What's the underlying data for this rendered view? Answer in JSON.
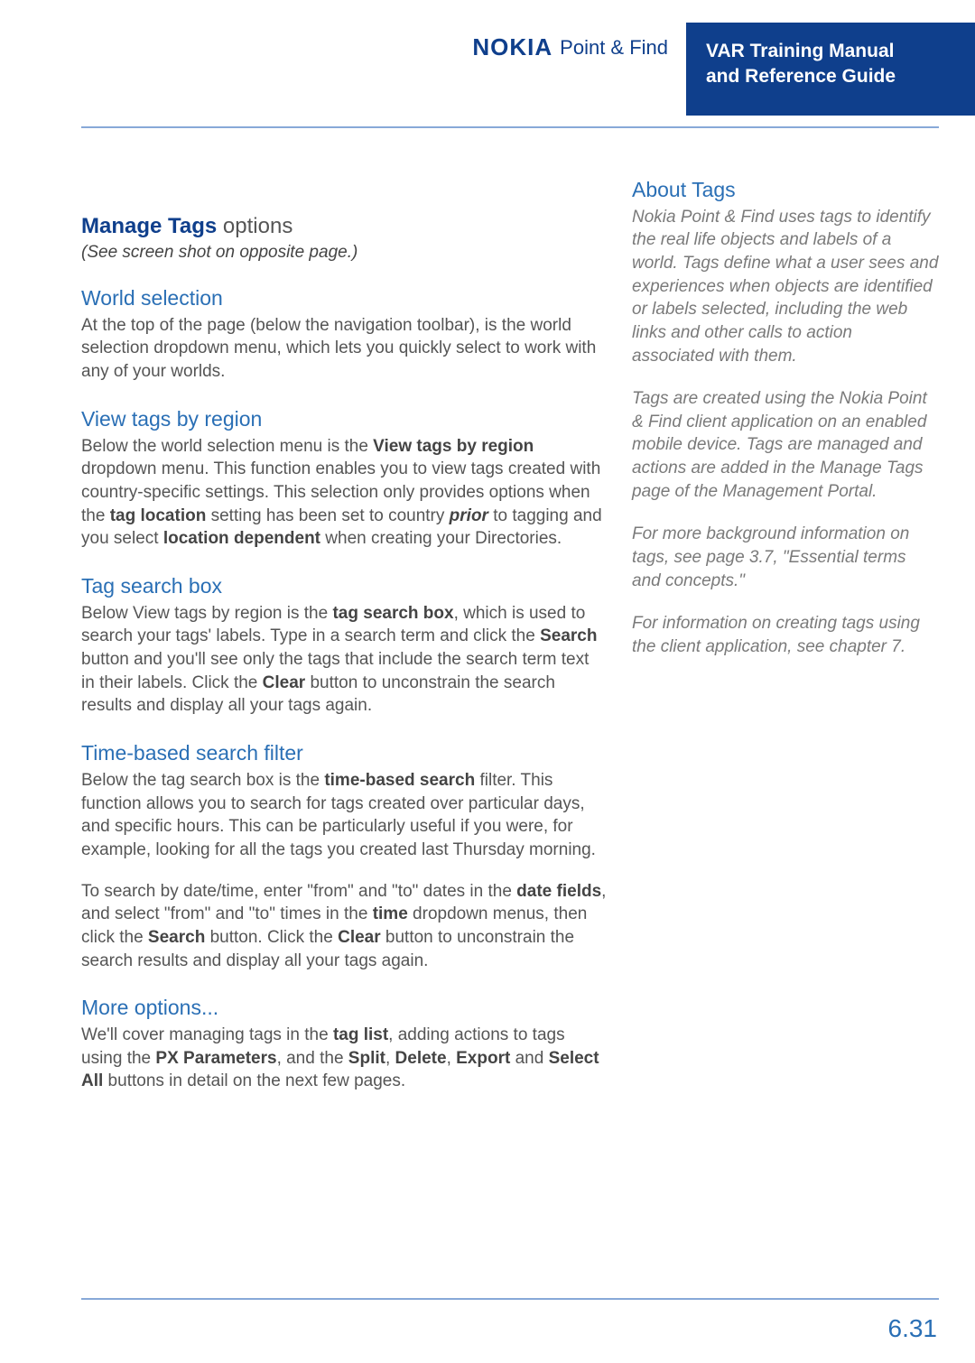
{
  "header": {
    "logo_brand": "NOKIA",
    "logo_product": "Point & Find",
    "badge_line1": "VAR Training Manual",
    "badge_line2": "and Reference Guide"
  },
  "main": {
    "manage_title_bold": "Manage Tags",
    "manage_title_rest": " options",
    "screenshot_note": "(See screen shot on opposite page.)",
    "world_selection_h": "World selection",
    "world_selection_body": "At the top of the page (below the navigation toolbar), is the world selection dropdown menu, which lets you quickly select to work with any of your worlds.",
    "view_tags_h": "View tags by region",
    "view_tags_body_1": "Below the world selection menu is the ",
    "view_tags_bold_1": "View tags by region",
    "view_tags_body_2": " dropdown menu. This function enables you to view tags created with country-specific settings.  This selection only provides options when the ",
    "view_tags_bold_2": "tag location",
    "view_tags_body_3": " setting has been set to country ",
    "view_tags_italic": "prior",
    "view_tags_body_4": " to tagging and you select ",
    "view_tags_bold_3": "location dependent",
    "view_tags_body_5": " when creating your Directories.",
    "tag_search_h": "Tag search box",
    "tag_search_1": "Below View tags by region is the ",
    "tag_search_b1": "tag search box",
    "tag_search_2": ", which is used to search your tags' labels. Type in a search term and click the ",
    "tag_search_b2": "Search",
    "tag_search_3": " button and you'll see only the tags that include the search term text in their labels.  Click the ",
    "tag_search_b3": "Clear",
    "tag_search_4": " button to unconstrain the search results and display all your tags again.",
    "time_h": "Time-based search filter",
    "time_1": "Below the tag search box is the ",
    "time_b1": "time-based search",
    "time_2": " filter.  This function allows you to search for tags created over particular days, and specific hours. This can be particularly useful if you were, for example, looking for all the tags you created last Thursday morning.",
    "time_3": "To search by date/time, enter \"from\" and \"to\" dates in the ",
    "time_b2": "date fields",
    "time_4": ", and select \"from\" and \"to\" times in the ",
    "time_b3": "time",
    "time_5": " dropdown menus, then click the ",
    "time_b4": "Search",
    "time_6": " button.  Click the ",
    "time_b5": "Clear",
    "time_7": " button to unconstrain the search results and display all your tags again.",
    "more_h": "More options...",
    "more_1": "We'll cover managing tags in the ",
    "more_b1": "tag list",
    "more_2": ", adding actions to tags using the ",
    "more_b2": "PX Parameters",
    "more_3": ", and the ",
    "more_b3": "Split",
    "more_c1": ", ",
    "more_b4": "Delete",
    "more_c2": ", ",
    "more_b5": "Export",
    "more_4": " and ",
    "more_b6": "Select All",
    "more_5": " buttons in detail on the next few pages."
  },
  "sidebar": {
    "title": "About Tags",
    "p1": "Nokia Point & Find uses tags to identify the real life objects and labels of a world. Tags define what a user sees and experiences when objects are identified or labels selected, including the web links and other calls to action associated with them.",
    "p2": "Tags are created using the Nokia Point & Find client application on an enabled mobile device. Tags are managed and actions are added in the Manage Tags page of the Management Portal.",
    "p3": "For more background information on tags, see page 3.7, \"Essential terms and concepts.\"",
    "p4": "For information on creating tags using the client application, see chapter 7."
  },
  "page_number": "6.31"
}
